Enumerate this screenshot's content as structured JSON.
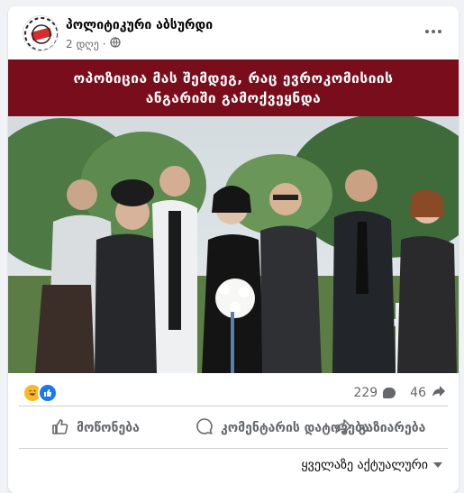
{
  "post": {
    "page_name": "პოლიტიკური აბსურდი",
    "time": "2 დღე",
    "audience_icon": "globe-icon",
    "menu_icon": "more-icon"
  },
  "image": {
    "banner_line1": "ოპოზიცია მას შემდეგ, რაც ევროკომისიის",
    "banner_line2": "ანგარიში გამოქვეყნდა",
    "colors": {
      "banner": "#7a0d1b",
      "sky": "#d7dde2",
      "trees": "#3f6a3a",
      "grass": "#5b7c45"
    }
  },
  "reactions": {
    "icons": [
      "haha-icon",
      "like-icon"
    ],
    "comments_count": "229",
    "shares_count": "46"
  },
  "actions": {
    "like": "მოწონება",
    "comment": "კომენტარის დატოვება",
    "share": "გაზიარება"
  },
  "sort": {
    "label": "ყველაზე აქტუალური"
  }
}
